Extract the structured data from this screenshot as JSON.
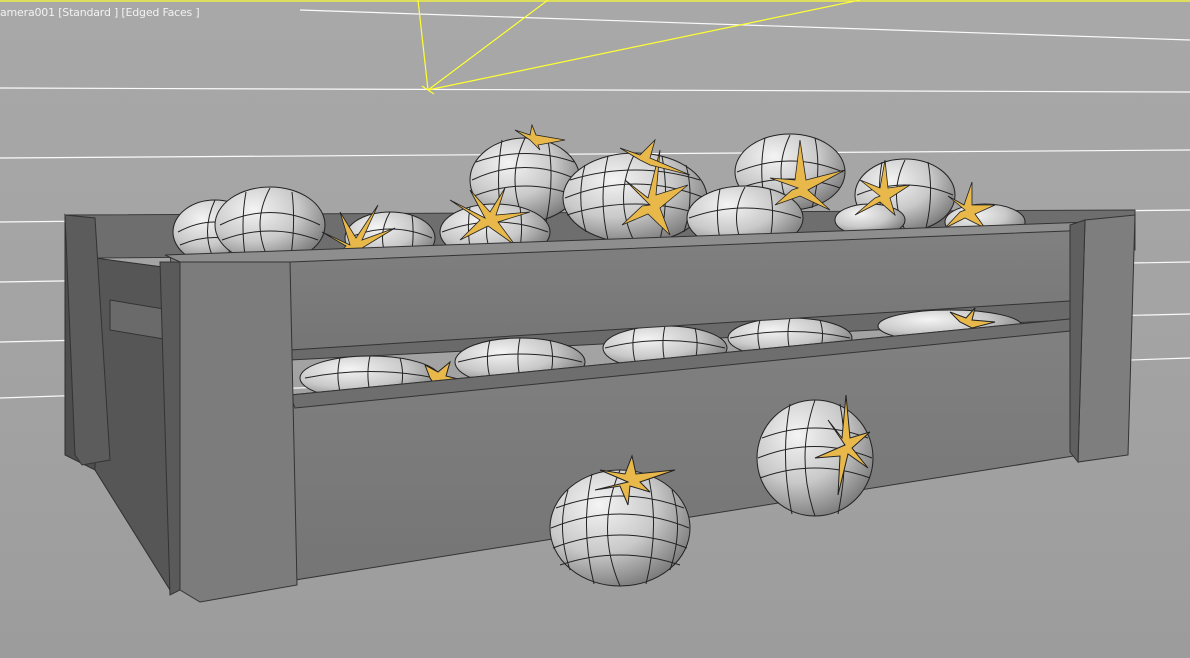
{
  "viewport": {
    "label_parts": [
      "amera001",
      "Standard",
      "Edged Faces"
    ],
    "colors": {
      "background": "#a4a4a4",
      "grid_lines": "#ffffff",
      "camera_wire": "#ffff33",
      "crate_face": "#7a7a7a",
      "crate_side": "#5e5e5e",
      "tomato_shading": "#d0d0d0",
      "stem_color": "#e8b94a"
    }
  }
}
